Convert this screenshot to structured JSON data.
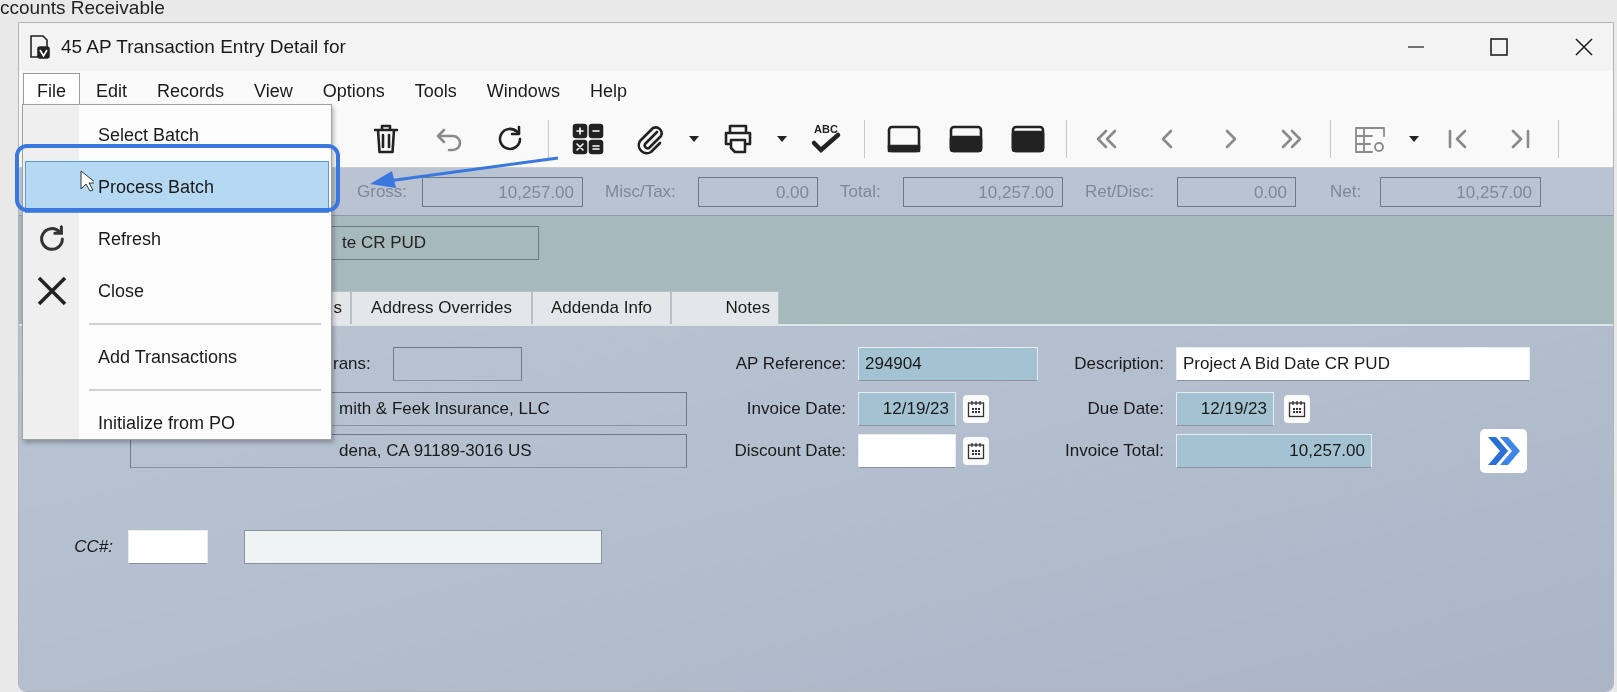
{
  "background": {
    "title": "ccounts Receivable"
  },
  "window": {
    "title": "45 AP Transaction Entry Detail for"
  },
  "menubar": [
    {
      "label": "File",
      "selected": true
    },
    {
      "label": "Edit",
      "selected": false
    },
    {
      "label": "Records",
      "selected": false
    },
    {
      "label": "View",
      "selected": false
    },
    {
      "label": "Options",
      "selected": false
    },
    {
      "label": "Tools",
      "selected": false
    },
    {
      "label": "Windows",
      "selected": false
    },
    {
      "label": "Help",
      "selected": false
    }
  ],
  "file_menu": [
    {
      "kind": "item",
      "label": "Select Batch",
      "selected": false
    },
    {
      "kind": "item",
      "label": "Process Batch",
      "selected": true
    },
    {
      "kind": "refresh",
      "label": "Refresh",
      "selected": false
    },
    {
      "kind": "close",
      "label": "Close",
      "selected": false
    },
    {
      "kind": "separator"
    },
    {
      "kind": "item",
      "label": "Add Transactions",
      "selected": false
    },
    {
      "kind": "separator"
    },
    {
      "kind": "item",
      "label": "Initialize from PO",
      "selected": false
    }
  ],
  "toolbar": [
    {
      "kind": "delete",
      "disabled": false
    },
    {
      "kind": "undo",
      "disabled": true
    },
    {
      "kind": "refresh",
      "disabled": false
    },
    {
      "kind": "separator"
    },
    {
      "kind": "calculator",
      "disabled": false
    },
    {
      "kind": "attach",
      "disabled": false
    },
    {
      "kind": "dropdown",
      "disabled": false
    },
    {
      "kind": "print",
      "disabled": false
    },
    {
      "kind": "dropdown",
      "disabled": false
    },
    {
      "kind": "spell",
      "label": "ABC",
      "disabled": false
    },
    {
      "kind": "separator"
    },
    {
      "kind": "panel-bottom",
      "disabled": false
    },
    {
      "kind": "panel-split",
      "disabled": false
    },
    {
      "kind": "panel-full",
      "disabled": false
    },
    {
      "kind": "separator"
    },
    {
      "kind": "first",
      "disabled": true
    },
    {
      "kind": "prev",
      "disabled": true
    },
    {
      "kind": "next",
      "disabled": true
    },
    {
      "kind": "last",
      "disabled": true
    },
    {
      "kind": "separator"
    },
    {
      "kind": "grid",
      "disabled": true
    },
    {
      "kind": "dropdown",
      "disabled": false
    },
    {
      "kind": "start",
      "disabled": true
    },
    {
      "kind": "end",
      "disabled": true
    },
    {
      "kind": "separator"
    }
  ],
  "totals": [
    {
      "label": "Gross:",
      "value": "10,257.00"
    },
    {
      "label": "Misc/Tax:",
      "value": "0.00"
    },
    {
      "label": "Total:",
      "value": "10,257.00"
    },
    {
      "label": "Ret/Disc:",
      "value": "0.00"
    },
    {
      "label": "Net:",
      "value": "10,257.00"
    }
  ],
  "header_description": {
    "value": "te CR PUD"
  },
  "tabs": [
    {
      "label": "s",
      "selected": false
    },
    {
      "label": "Address Overrides",
      "selected": false
    },
    {
      "label": "Addenda Info",
      "selected": false
    },
    {
      "label": "Notes",
      "selected": false
    }
  ],
  "trans": {
    "label": "rans:"
  },
  "vendor_name": {
    "value": "mith & Feek Insurance, LLC"
  },
  "vendor_address": {
    "value": "dena, CA  91189-3016  US"
  },
  "ap_reference": {
    "label": "AP Reference:",
    "value": "294904",
    "locked": true
  },
  "description": {
    "label": "Description:",
    "value": "Project A Bid Date CR PUD",
    "locked": false
  },
  "invoice_date": {
    "label": "Invoice Date:",
    "value": "12/19/23",
    "locked": true
  },
  "due_date": {
    "label": "Due Date:",
    "value": "12/19/23",
    "locked": true
  },
  "discount_date": {
    "label": "Discount Date:",
    "locked": false
  },
  "invoice_total": {
    "label": "Invoice Total:",
    "value": "10,257.00",
    "locked": true
  },
  "cc": {
    "label": "CC#:"
  }
}
